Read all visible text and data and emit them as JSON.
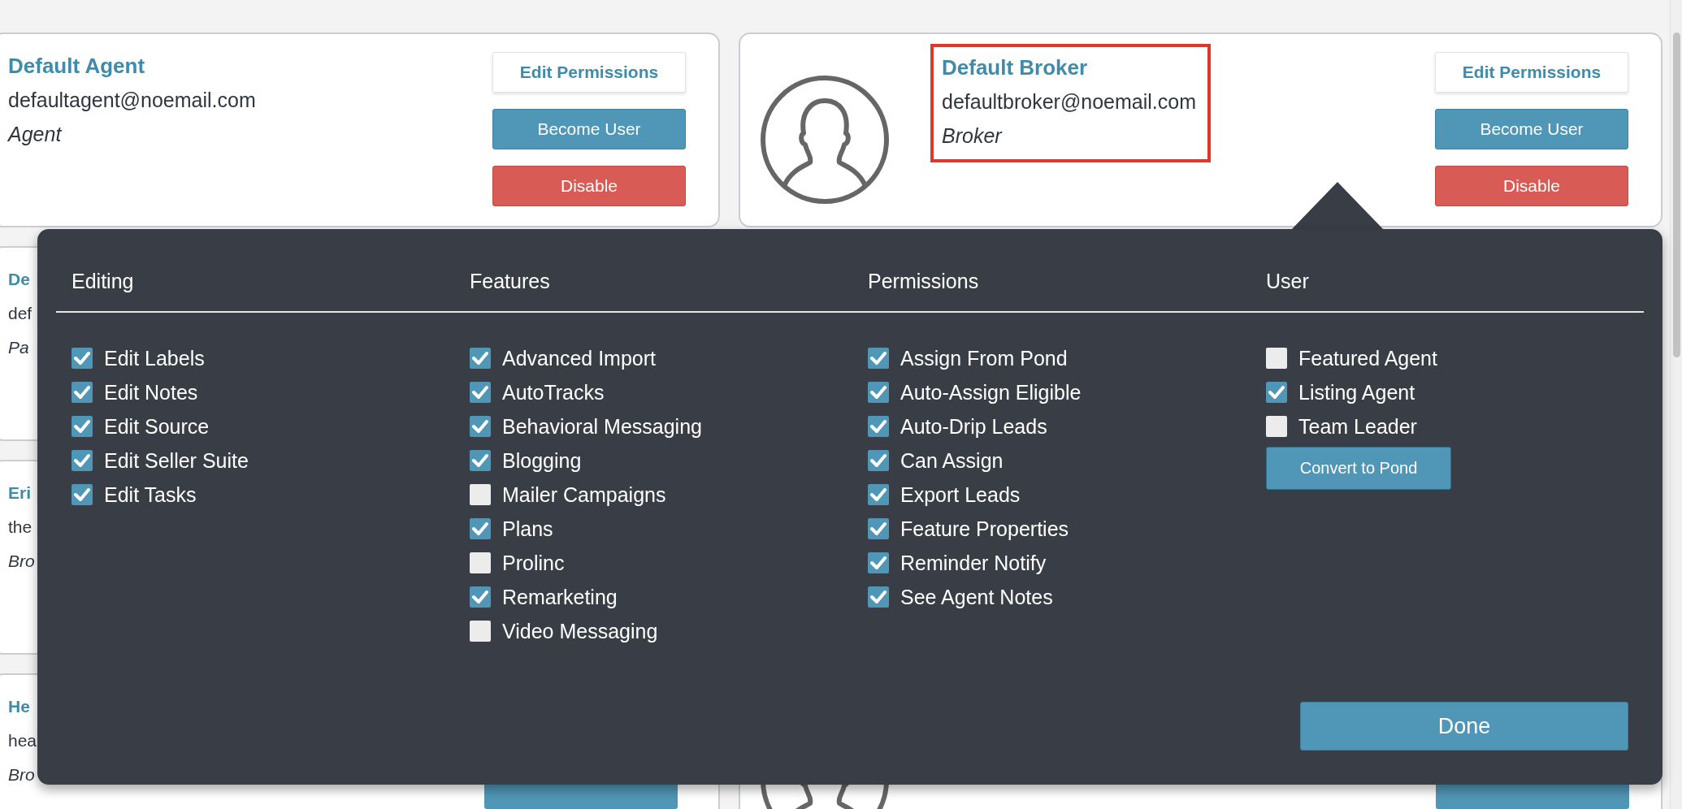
{
  "left_cards": [
    {
      "kind": "full",
      "name": "Default Agent",
      "email": "defaultagent@noemail.com",
      "role": "Agent",
      "buttons": [
        {
          "kind": "edit",
          "label": "Edit Permissions"
        },
        {
          "kind": "become",
          "label": "Become User"
        },
        {
          "kind": "disable",
          "label": "Disable"
        }
      ]
    },
    {
      "kind": "covered",
      "name": "De",
      "email": "def",
      "role": "Pa"
    },
    {
      "kind": "covered",
      "name": "Eri",
      "email": "the",
      "role": "Bro"
    },
    {
      "kind": "covered",
      "name": "He",
      "email": "hea",
      "role": "Bro"
    }
  ],
  "right_card": {
    "name": "Default Broker",
    "email": "defaultbroker@noemail.com",
    "role": "Broker",
    "highlighted": true,
    "buttons": [
      {
        "kind": "edit",
        "label": "Edit Permissions"
      },
      {
        "kind": "become",
        "label": "Become User"
      },
      {
        "kind": "disable",
        "label": "Disable"
      }
    ]
  },
  "permissions_popup": {
    "columns": [
      {
        "title": "Editing",
        "items": [
          {
            "label": "Edit Labels",
            "checked": true
          },
          {
            "label": "Edit Notes",
            "checked": true
          },
          {
            "label": "Edit Source",
            "checked": true
          },
          {
            "label": "Edit Seller Suite",
            "checked": true
          },
          {
            "label": "Edit Tasks",
            "checked": true
          }
        ]
      },
      {
        "title": "Features",
        "items": [
          {
            "label": "Advanced Import",
            "checked": true
          },
          {
            "label": "AutoTracks",
            "checked": true
          },
          {
            "label": "Behavioral Messaging",
            "checked": true
          },
          {
            "label": "Blogging",
            "checked": true
          },
          {
            "label": "Mailer Campaigns",
            "checked": false
          },
          {
            "label": "Plans",
            "checked": true
          },
          {
            "label": "Prolinc",
            "checked": false
          },
          {
            "label": "Remarketing",
            "checked": true
          },
          {
            "label": "Video Messaging",
            "checked": false
          }
        ]
      },
      {
        "title": "Permissions",
        "items": [
          {
            "label": "Assign From Pond",
            "checked": true
          },
          {
            "label": "Auto-Assign Eligible",
            "checked": true
          },
          {
            "label": "Auto-Drip Leads",
            "checked": true
          },
          {
            "label": "Can Assign",
            "checked": true
          },
          {
            "label": "Export Leads",
            "checked": true
          },
          {
            "label": "Feature Properties",
            "checked": true
          },
          {
            "label": "Reminder Notify",
            "checked": true
          },
          {
            "label": "See Agent Notes",
            "checked": true
          }
        ]
      },
      {
        "title": "User",
        "items": [
          {
            "label": "Featured Agent",
            "checked": false
          },
          {
            "label": "Listing Agent",
            "checked": true
          },
          {
            "label": "Team Leader",
            "checked": false
          }
        ],
        "button": "Convert to Pond"
      }
    ],
    "done_button": "Done"
  }
}
